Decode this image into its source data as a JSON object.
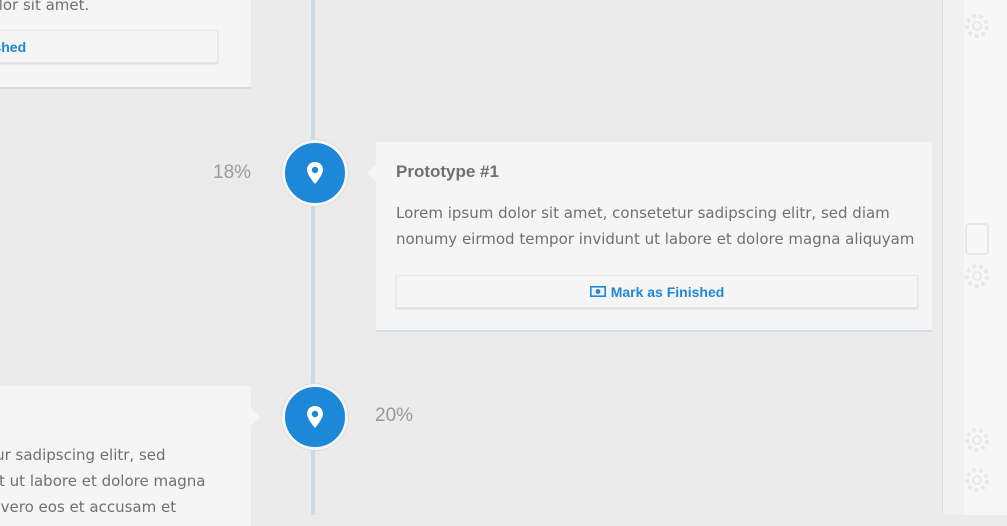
{
  "top_card": {
    "body_fragment": "dolor sit amet.",
    "button_label": "nished"
  },
  "milestone_1": {
    "percent": "18%",
    "title": "Prototype #1",
    "body": "Lorem ipsum dolor sit amet, consetetur sadipscing elitr, sed diam nonumy eirmod tempor invidunt ut labore et dolore magna aliquyam",
    "button_label": "Mark as Finished",
    "button_icon": "money-icon"
  },
  "milestone_2": {
    "percent": "20%",
    "body_fragment": "etur sadipscing elitr, sed\nunt ut labore et dolore magna\nAt vero eos et accusam et"
  },
  "colors": {
    "accent": "#1e88d8",
    "background": "#ebebeb",
    "card": "#f5f5f5",
    "timeline": "#cdd9e3",
    "muted_text": "#9a9a9a"
  },
  "icons": {
    "marker_icon": "map-pin-icon",
    "decorations": [
      "gear-icon",
      "gear-icon",
      "gear-icon"
    ]
  }
}
